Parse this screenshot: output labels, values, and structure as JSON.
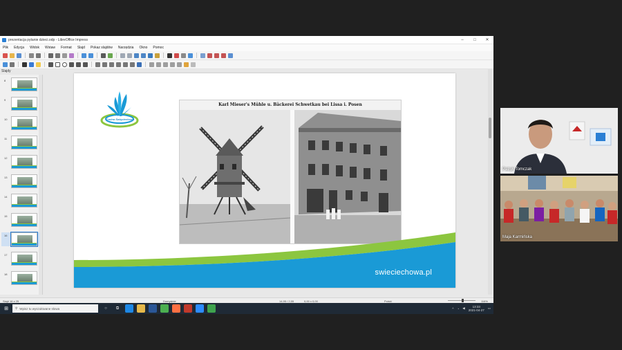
{
  "window": {
    "title": "prezentacja pytanie dzieci.odp - LibreOffice Impress",
    "controls": [
      "–",
      "□",
      "✕"
    ]
  },
  "menubar": {
    "items": [
      "Plik",
      "Edycja",
      "Widok",
      "Wstaw",
      "Format",
      "Slajd",
      "Pokaz slajdów",
      "Narzędzia",
      "Okno",
      "Pomoc"
    ]
  },
  "slides_panel": {
    "title": "Slajdy",
    "numbers": [
      "8",
      "9",
      "10",
      "11",
      "12",
      "13",
      "14",
      "15",
      "16",
      "17",
      "18"
    ],
    "selected_index": 8
  },
  "slide": {
    "logo_text": "Gmina Święciechowa",
    "photo_caption": "Karl Mieser's Mühle u. Bäckerei Schwetkau bei Lissa i. Posen",
    "footer_url": "swieciechowa.pl",
    "colors": {
      "green": "#8cc63f",
      "blue": "#1a9ad6"
    }
  },
  "statusbar": {
    "slide_info": "Slajd 16 z 25",
    "layout": "Domyślnie",
    "position": "14,95 / 2,55",
    "size": "0,00 x 0,00",
    "language": "Polski",
    "zoom": "116%"
  },
  "taskbar": {
    "search_placeholder": "Wpisz tu wyszukiwane słowa",
    "time": "13:33",
    "date": "2021-04-27"
  },
  "participants": [
    {
      "name": "Patryk Tomczak"
    },
    {
      "name": "Maja Karmińska"
    }
  ]
}
